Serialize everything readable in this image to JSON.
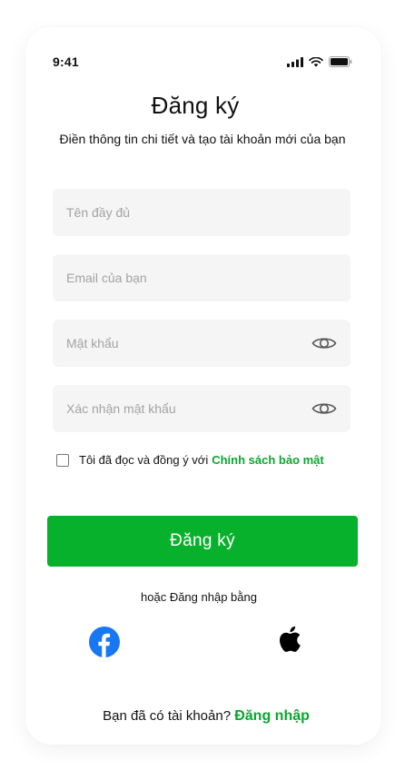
{
  "status_bar": {
    "time": "9:41",
    "icons": [
      "signal-icon",
      "wifi-icon",
      "battery-icon"
    ]
  },
  "header": {
    "title": "Đăng ký",
    "subtitle": "Điền thông tin chi tiết và tạo tài khoản mới của bạn"
  },
  "form": {
    "full_name": {
      "placeholder": "Tên đầy đủ",
      "value": ""
    },
    "email": {
      "placeholder": "Email của bạn",
      "value": ""
    },
    "password": {
      "placeholder": "Mật khẩu",
      "value": "",
      "icon": "eye-icon"
    },
    "confirm_password": {
      "placeholder": "Xác nhận mật khẩu",
      "value": "",
      "icon": "eye-icon"
    },
    "agree": {
      "text": "Tôi đã đọc và đồng ý với",
      "link": "Chính sách bảo mật",
      "checked": false
    },
    "submit_label": "Đăng ký"
  },
  "social": {
    "label": "hoặc Đăng nhập bằng",
    "providers": [
      "facebook-icon",
      "apple-icon"
    ]
  },
  "footer": {
    "prompt": "Bạn đã có tài khoản?",
    "link": "Đăng nhập"
  },
  "colors": {
    "accent": "#08b12c",
    "link": "#0aa630",
    "field_bg": "#f5f5f5",
    "facebook": "#1877f2"
  }
}
